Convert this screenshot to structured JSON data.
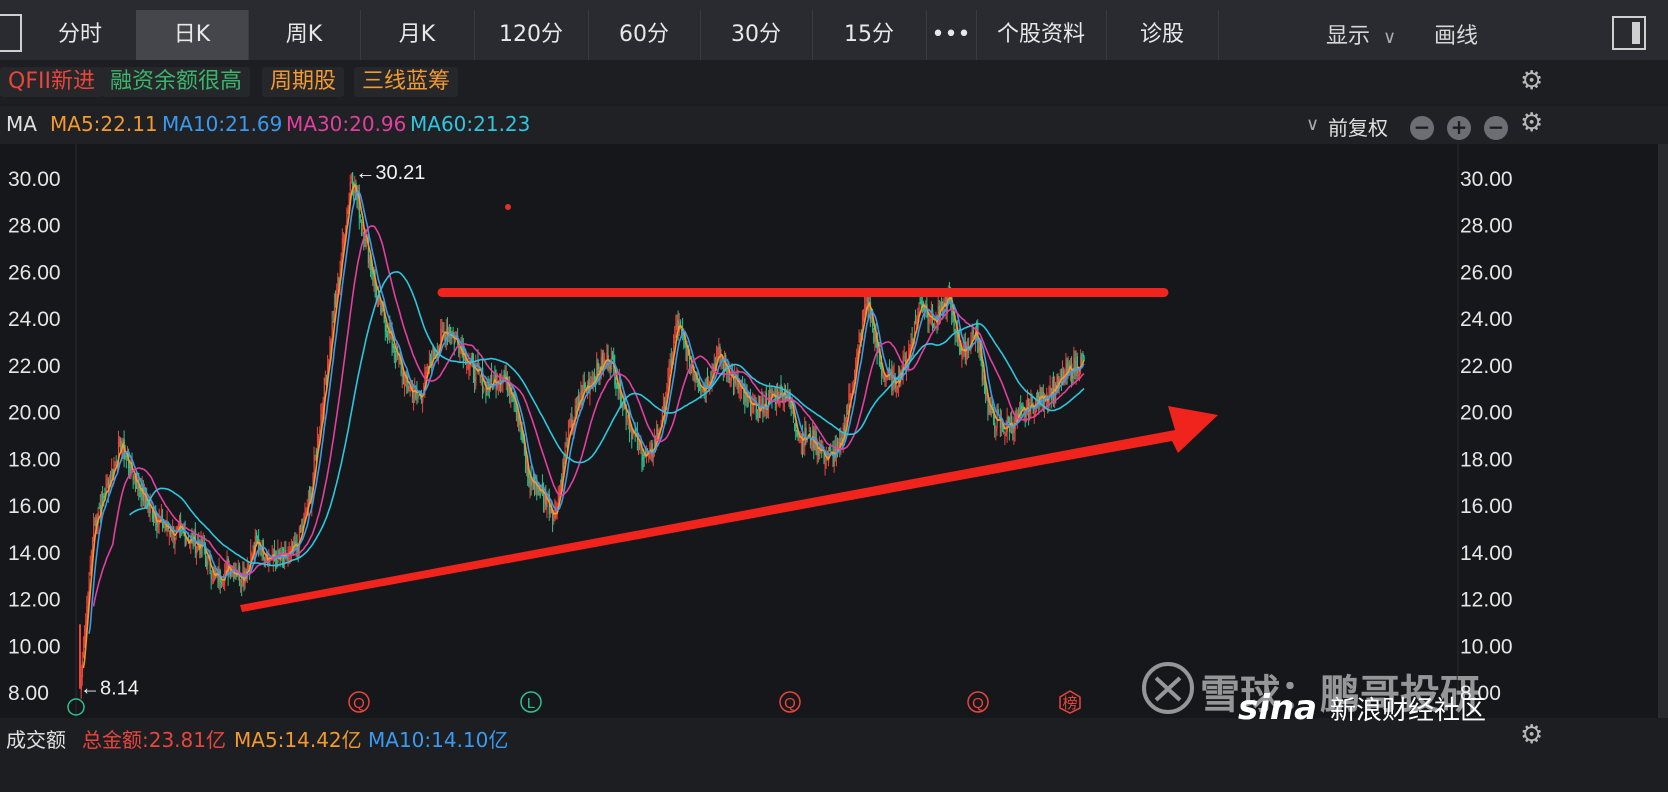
{
  "tabs": [
    {
      "label": "分时",
      "active": false
    },
    {
      "label": "日K",
      "active": true
    },
    {
      "label": "周K",
      "active": false
    },
    {
      "label": "月K",
      "active": false
    },
    {
      "label": "120分",
      "active": false
    },
    {
      "label": "60分",
      "active": false
    },
    {
      "label": "30分",
      "active": false
    },
    {
      "label": "15分",
      "active": false
    },
    {
      "label": "•••",
      "active": false
    },
    {
      "label": "个股资料",
      "active": false
    },
    {
      "label": "诊股",
      "active": false
    }
  ],
  "toolbar": {
    "display_label": "显示",
    "draw_label": "画线"
  },
  "tags": [
    {
      "label": "QFII新进",
      "color": "#e8453c"
    },
    {
      "label": "融资余额很高",
      "color": "#3bb56a"
    },
    {
      "label": "周期股",
      "color": "#f29a2e"
    },
    {
      "label": "三线蓝筹",
      "color": "#f29a2e"
    }
  ],
  "ma_bar": {
    "label": "MA",
    "ma5": "MA5:22.11",
    "ma10": "MA10:21.69",
    "ma30": "MA30:20.96",
    "ma60": "MA60:21.23",
    "adjust": "前复权"
  },
  "colors": {
    "up": "#e8453c",
    "down": "#2ec28b",
    "ma5": "#f29a2e",
    "ma10": "#3a9af0",
    "ma30": "#e040a0",
    "ma60": "#2cc6e0"
  },
  "chart_data": {
    "type": "candlestick",
    "y_ticks": [
      "30.00",
      "28.00",
      "26.00",
      "24.00",
      "22.00",
      "20.00",
      "18.00",
      "16.00",
      "14.00",
      "12.00",
      "10.00",
      "8.00"
    ],
    "ylim": [
      8,
      31
    ],
    "anchor_prices": [
      8.14,
      15.2,
      16.8,
      18.6,
      17.2,
      16.0,
      15.2,
      14.8,
      14.6,
      14.2,
      12.8,
      13.4,
      13.0,
      14.4,
      13.8,
      13.6,
      14.2,
      16.5,
      21.0,
      25.5,
      30.21,
      27.5,
      24.6,
      23.0,
      21.2,
      20.6,
      22.4,
      23.6,
      22.8,
      21.8,
      21.0,
      21.6,
      20.8,
      17.2,
      16.6,
      15.6,
      19.0,
      20.8,
      21.6,
      22.4,
      20.5,
      18.6,
      18.0,
      20.0,
      23.8,
      22.0,
      21.0,
      22.4,
      21.6,
      20.5,
      20.1,
      20.6,
      20.9,
      19.0,
      18.8,
      18.0,
      18.3,
      21.5,
      24.9,
      21.8,
      21.2,
      22.4,
      24.8,
      23.8,
      24.9,
      22.4,
      23.5,
      20.0,
      19.3,
      19.6,
      20.2,
      20.7,
      21.1,
      21.8,
      22.2
    ],
    "max_label": "←30.21",
    "min_label": "←8.14",
    "event_markers": [
      {
        "label": "Q",
        "color": "#e8453c",
        "kind": "circle"
      },
      {
        "label": "L",
        "color": "#2ec28b",
        "kind": "circle"
      },
      {
        "label": "Q",
        "color": "#e8453c",
        "kind": "circle"
      },
      {
        "label": "Q",
        "color": "#e8453c",
        "kind": "circle"
      },
      {
        "label": "榜",
        "color": "#e8453c",
        "kind": "hex"
      }
    ],
    "annotations": [
      {
        "type": "resistance_line",
        "price": 25.1
      },
      {
        "type": "uptrend_arrow"
      }
    ]
  },
  "volume_bar": {
    "label": "成交额",
    "total": "总金额:23.81亿",
    "ma5": "MA5:14.42亿",
    "ma10": "MA10:14.10亿"
  },
  "watermark": {
    "xueqiu": "雪球：鹏哥投研",
    "sina": "新浪财经社区",
    "sina_logo": "sina"
  }
}
